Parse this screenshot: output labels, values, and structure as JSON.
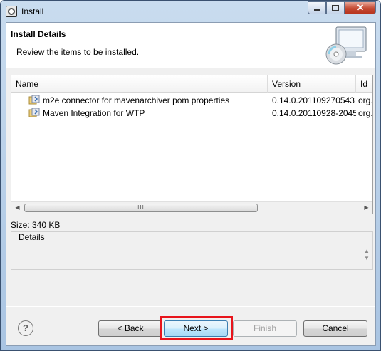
{
  "window": {
    "title": "Install"
  },
  "header": {
    "title": "Install Details",
    "description": "Review the items to be installed."
  },
  "table": {
    "columns": [
      "Name",
      "Version",
      "Id"
    ],
    "rows": [
      {
        "name": "m2e connector for mavenarchiver pom properties",
        "version": "0.14.0.201109270543",
        "id": "org."
      },
      {
        "name": "Maven Integration for WTP",
        "version": "0.14.0.20110928-2045",
        "id": "org."
      }
    ],
    "scroll_thumb_text": "III"
  },
  "size": "Size: 340 KB",
  "details": {
    "label": "Details"
  },
  "buttons": {
    "back": "< Back",
    "next": "Next >",
    "finish": "Finish",
    "cancel": "Cancel",
    "help": "?"
  },
  "colors": {
    "highlight": "#e8141b",
    "title_bar": "#b9d1ea",
    "close_button": "#c44a33"
  },
  "icons": [
    "app-icon",
    "minimize-icon",
    "maximize-icon",
    "close-icon",
    "wizard-monitor-cd-icon",
    "feature-icon",
    "help-icon"
  ]
}
